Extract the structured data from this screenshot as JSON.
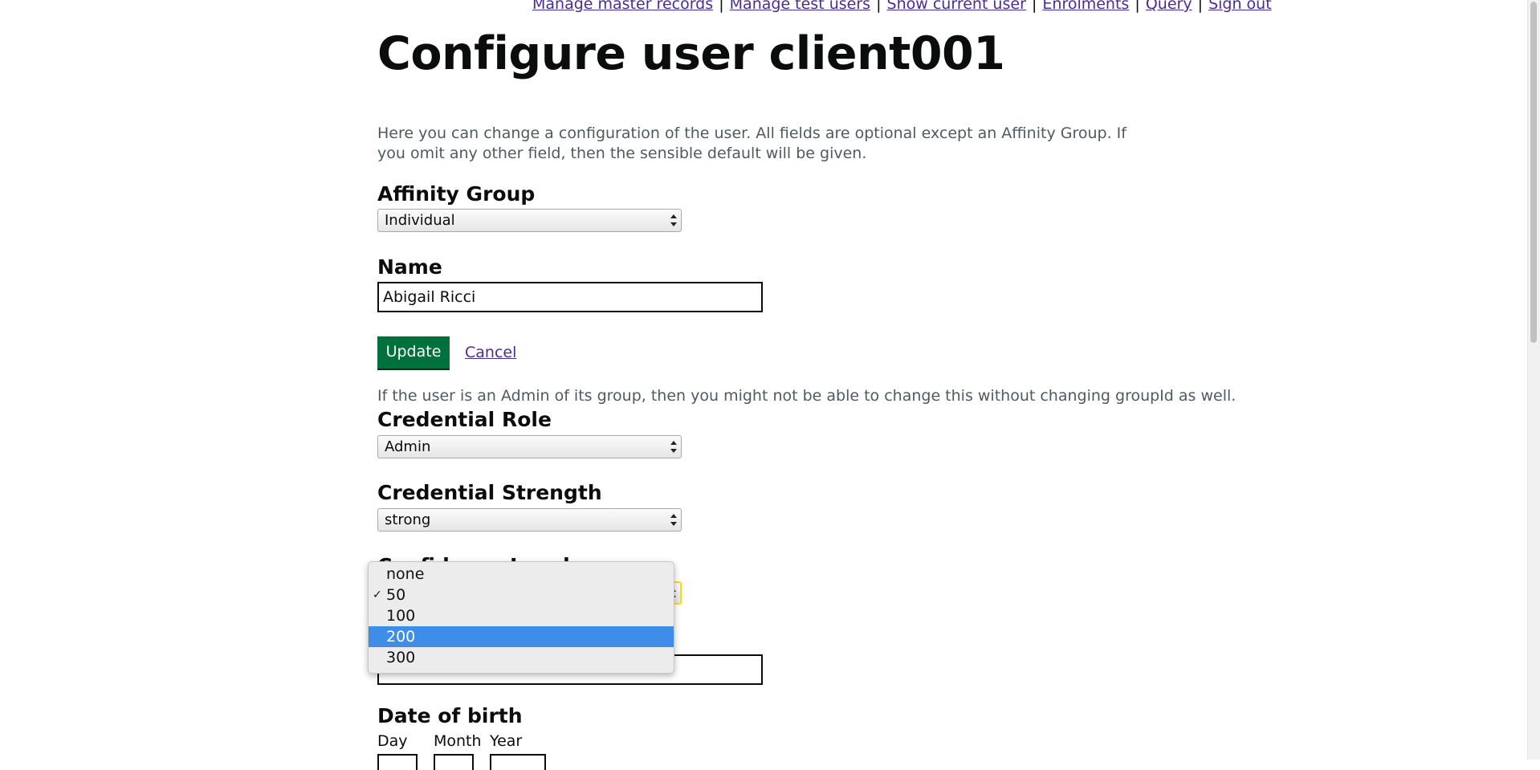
{
  "nav": {
    "links": [
      "Manage master records",
      "Manage test users",
      "Show current user",
      "Enrolments",
      "Query",
      "Sign out"
    ],
    "separator": "|"
  },
  "page": {
    "title": "Configure user client001",
    "intro": "Here you can change a configuration of the user. All fields are optional except an Affinity Group. If you omit any other field, then the sensible default will be given."
  },
  "form": {
    "affinity_group": {
      "label": "Affinity Group",
      "value": "Individual"
    },
    "name": {
      "label": "Name",
      "value": "Abigail Ricci"
    },
    "update_label": "Update",
    "cancel_label": "Cancel",
    "admin_warning": "If the user is an Admin of its group, then you might not be able to change this without changing groupId as well.",
    "credential_role": {
      "label": "Credential Role",
      "value": "Admin"
    },
    "credential_strength": {
      "label": "Credential Strength",
      "value": "strong"
    },
    "confidence_level": {
      "label": "Confidence Level",
      "options": [
        "none",
        "50",
        "100",
        "200",
        "300"
      ],
      "checked": "50",
      "highlighted": "200",
      "check_mark": "✓"
    },
    "date_of_birth": {
      "label": "Date of birth",
      "day_label": "Day",
      "month_label": "Month",
      "year_label": "Year"
    }
  },
  "colors": {
    "link": "#4c2c92",
    "button": "#00703c",
    "highlight": "#3e8de9",
    "focus": "#ffdd00"
  }
}
